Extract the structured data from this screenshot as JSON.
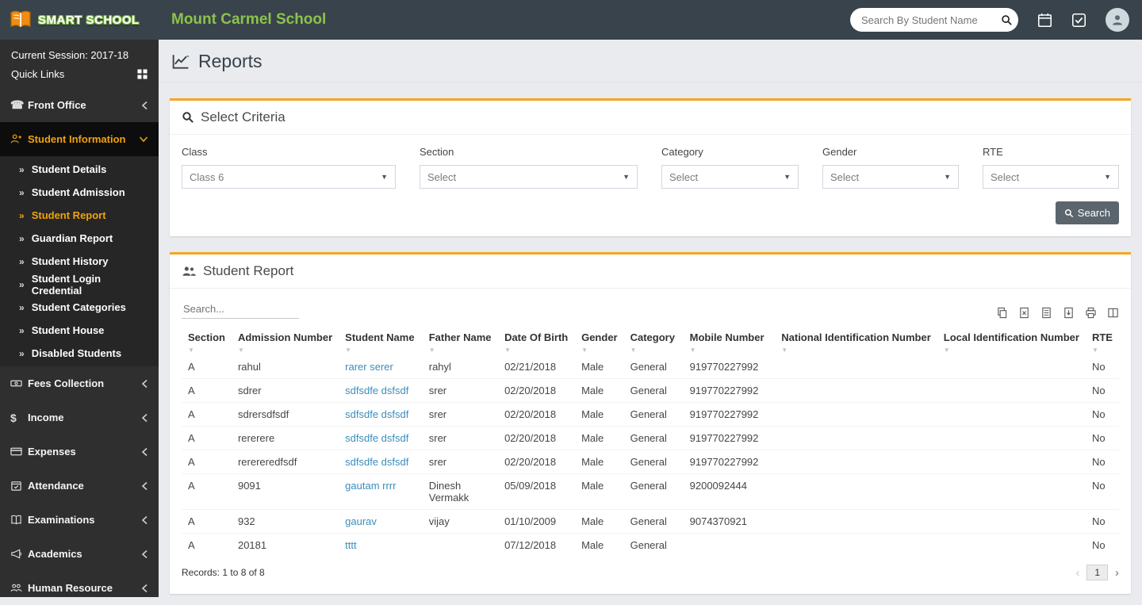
{
  "colors": {
    "accent_orange": "#f0a30a",
    "topbar_bg": "#39434b",
    "sidebar_bg": "#2f2f2f",
    "brand_green": "#8bc34a",
    "link_blue": "#3c8dbc"
  },
  "topbar": {
    "logo_text": "SMART SCHOOL",
    "school_name": "Mount Carmel School",
    "search_placeholder": "Search By Student Name",
    "icons": [
      "calendar",
      "tasks",
      "user-avatar"
    ]
  },
  "sidebar": {
    "session": "Current Session: 2017-18",
    "quick_links": "Quick Links",
    "menu": [
      {
        "label": "Front Office",
        "icon": "phone"
      },
      {
        "label": "Student Information",
        "icon": "student"
      },
      {
        "label": "Fees Collection",
        "icon": "money"
      },
      {
        "label": "Income",
        "icon": "dollar"
      },
      {
        "label": "Expenses",
        "icon": "card"
      },
      {
        "label": "Attendance",
        "icon": "calendar-check"
      },
      {
        "label": "Examinations",
        "icon": "book"
      },
      {
        "label": "Academics",
        "icon": "megaphone"
      },
      {
        "label": "Human Resource",
        "icon": "people"
      }
    ],
    "submenu": [
      "Student Details",
      "Student Admission",
      "Student Report",
      "Guardian Report",
      "Student History",
      "Student Login Credential",
      "Student Categories",
      "Student House",
      "Disabled Students"
    ],
    "active_menu": "Student Information",
    "active_submenu": "Student Report"
  },
  "page": {
    "title": "Reports"
  },
  "criteria": {
    "title": "Select Criteria",
    "fields": [
      {
        "label": "Class",
        "value": "Class 6"
      },
      {
        "label": "Section",
        "value": "Select"
      },
      {
        "label": "Category",
        "value": "Select"
      },
      {
        "label": "Gender",
        "value": "Select"
      },
      {
        "label": "RTE",
        "value": "Select"
      }
    ],
    "search_button": "Search"
  },
  "report": {
    "title": "Student Report",
    "search_placeholder": "Search...",
    "export_icons": [
      "copy",
      "excel",
      "csv",
      "pdf",
      "print",
      "columns"
    ],
    "columns": [
      "Section",
      "Admission Number",
      "Student Name",
      "Father Name",
      "Date Of Birth",
      "Gender",
      "Category",
      "Mobile Number",
      "National Identification Number",
      "Local Identification Number",
      "RTE"
    ],
    "column_keys": [
      "section",
      "admission-number",
      "student-name",
      "father-name",
      "date-of-birth",
      "gender",
      "category",
      "mobile-number",
      "national-identification-number",
      "local-identification-number",
      "rte"
    ],
    "rows": [
      [
        "A",
        "rahul",
        "rarer serer",
        "rahyl",
        "02/21/2018",
        "Male",
        "General",
        "919770227992",
        "",
        "",
        "No"
      ],
      [
        "A",
        "sdrer",
        "sdfsdfe dsfsdf",
        "srer",
        "02/20/2018",
        "Male",
        "General",
        "919770227992",
        "",
        "",
        "No"
      ],
      [
        "A",
        "sdrersdfsdf",
        "sdfsdfe dsfsdf",
        "srer",
        "02/20/2018",
        "Male",
        "General",
        "919770227992",
        "",
        "",
        "No"
      ],
      [
        "A",
        "rererere",
        "sdfsdfe dsfsdf",
        "srer",
        "02/20/2018",
        "Male",
        "General",
        "919770227992",
        "",
        "",
        "No"
      ],
      [
        "A",
        "rerereredfsdf",
        "sdfsdfe dsfsdf",
        "srer",
        "02/20/2018",
        "Male",
        "General",
        "919770227992",
        "",
        "",
        "No"
      ],
      [
        "A",
        "9091",
        "gautam rrrr",
        "Dinesh Vermakk",
        "05/09/2018",
        "Male",
        "General",
        "9200092444",
        "",
        "",
        "No"
      ],
      [
        "A",
        "932",
        "gaurav",
        "vijay",
        "01/10/2009",
        "Male",
        "General",
        "9074370921",
        "",
        "",
        "No"
      ],
      [
        "A",
        "20181",
        "tttt",
        "",
        "07/12/2018",
        "Male",
        "General",
        "",
        "",
        "",
        "No"
      ]
    ],
    "records_text": "Records: 1 to 8 of 8",
    "pagination": {
      "prev": "‹",
      "page": "1",
      "next": "›"
    }
  }
}
